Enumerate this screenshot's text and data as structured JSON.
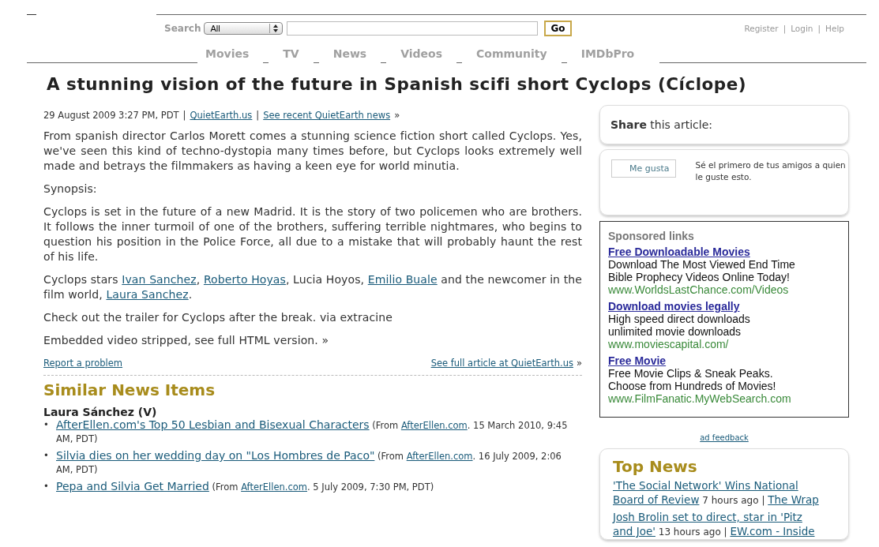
{
  "header": {
    "search_label": "Search",
    "scope": "All",
    "go_button": "Go",
    "account_links": [
      "Register",
      "Login",
      "Help"
    ],
    "account_separator": "|"
  },
  "nav": {
    "tabs": [
      {
        "label": "Movies"
      },
      {
        "label": "TV"
      },
      {
        "label": "News"
      },
      {
        "label": "Videos"
      },
      {
        "label": "Community"
      },
      {
        "label": "IMDbPro"
      }
    ]
  },
  "article": {
    "title": "A stunning vision of the future in Spanish scifi short Cyclops (Cíclope)",
    "meta": {
      "date": "29 August 2009 3:27 PM, PDT",
      "separator": "|",
      "source_link": "QuietEarth.us",
      "recent_link": "See recent QuietEarth news",
      "arrow": "»"
    },
    "paragraphs": [
      [
        {
          "kind": "text",
          "text": "From spanish director Carlos Morett comes a stunning science fiction short called Cyclops. Yes, we've seen this kind of techno-dystopia many times before, but Cyclops looks extremely well made and betrays the filmmakers as having a keen eye for world minutia."
        }
      ],
      [
        {
          "kind": "text",
          "text": "Synopsis:"
        }
      ],
      [
        {
          "kind": "text",
          "text": "Cyclops is set in the future of a new Madrid. It is the story of two policemen who are brothers. It follows the inner turmoil of one of the brothers, suffering terrible nightmares, who begins to question his position in the Police Force, all due to a mistake that will probably haunt the rest of his life."
        }
      ],
      [
        {
          "kind": "text",
          "text": "Cyclops stars "
        },
        {
          "kind": "link",
          "text": "Ivan Sanchez"
        },
        {
          "kind": "text",
          "text": ", "
        },
        {
          "kind": "link",
          "text": "Roberto Hoyas"
        },
        {
          "kind": "text",
          "text": ", Lucia Hoyos, "
        },
        {
          "kind": "link",
          "text": "Emilio Buale"
        },
        {
          "kind": "text",
          "text": " and the newcomer in the film world, "
        },
        {
          "kind": "link",
          "text": "Laura Sanchez"
        },
        {
          "kind": "text",
          "text": "."
        }
      ],
      [
        {
          "kind": "text",
          "text": "Check out the trailer for Cyclops after the break. via extracine"
        }
      ],
      [
        {
          "kind": "text",
          "text": "Embedded video stripped, see full HTML version. »"
        }
      ]
    ],
    "report_link": "Report a problem",
    "full_article_link": "See full article at QuietEarth.us",
    "full_article_arrow": "»"
  },
  "similar": {
    "heading": "Similar News Items",
    "subject": "Laura Sánchez (V)",
    "bullet": "•",
    "items": [
      {
        "title": "AfterEllen.com's Top 50 Lesbian and Bisexual Characters",
        "from": "(From",
        "source": "AfterEllen.com",
        "date": ". 15 March 2010, 9:45",
        "date_continued": "AM, PDT)"
      },
      {
        "title": "Silvia dies on her wedding day on \"Los Hombres de Paco\"",
        "from": "(From",
        "source": "AfterEllen.com",
        "date": ". 16 July 2009, 2:06",
        "date_continued": "AM, PDT)"
      },
      {
        "title": "Pepa and Silvia Get Married",
        "from": "(From",
        "source": "AfterEllen.com",
        "date": ". 5 July 2009, 7:30 PM, PDT)"
      }
    ]
  },
  "sidebar": {
    "share": "**Share** this article:",
    "like_button": "Me gusta",
    "like_text": "Sé el primero de tus amigos a quien le guste esto.",
    "sponsored": {
      "heading": "Sponsored links",
      "ads": [
        {
          "title": "Free Downloadable Movies",
          "lines": [
            "Download The Most Viewed End Time",
            "Bible Prophecy Videos Online Today!"
          ],
          "url": "www.WorldsLastChance.com/Videos"
        },
        {
          "title": "Download movies legally",
          "lines": [
            "High speed direct downloads",
            "unlimited movie downloads"
          ],
          "url": "www.moviescapital.com/"
        },
        {
          "title": "Free Movie",
          "lines": [
            "Free Movie Clips & Sneak Peaks.",
            "Choose from Hundreds of Movies!"
          ],
          "url": "www.FilmFanatic.MyWebSearch.com"
        }
      ]
    },
    "ad_feedback": "ad feedback",
    "top_news": {
      "heading": "Top News",
      "items": [
        {
          "title_lines": [
            "'The Social Network' Wins National",
            "Board of Review"
          ],
          "age": "7 hours ago |",
          "source": "The Wrap"
        },
        {
          "title_lines": [
            "Josh Brolin set to direct, star in 'Pitz",
            "and Joe'"
          ],
          "age": "13 hours ago |",
          "source": "EW.com - Inside"
        }
      ]
    }
  }
}
